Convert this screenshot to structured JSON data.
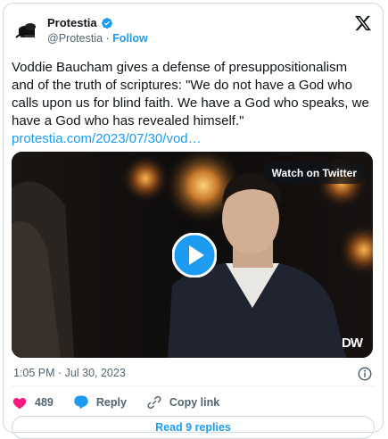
{
  "tweet": {
    "author_name": "Protestia",
    "handle": "@Protestia",
    "separator": "·",
    "follow_label": "Follow",
    "text": "Voddie Baucham gives a defense of presuppositionalism and of the truth of scriptures: \"We do not have a God who calls upon us for blind faith. We have a God who speaks, we have a God who has revealed himself.\" ",
    "link_text": "protestia.com/2023/07/30/vod…",
    "timestamp": "1:05 PM · Jul 30, 2023"
  },
  "video": {
    "watch_label": "Watch on Twitter",
    "watermark": "DW"
  },
  "actions": {
    "like_count": "489",
    "reply_label": "Reply",
    "copy_label": "Copy link"
  },
  "read_replies_label": "Read 9 replies",
  "colors": {
    "accent": "#1d9bf0",
    "like": "#f91880",
    "text": "#0f1419",
    "muted": "#536471",
    "border": "#cfd9de"
  }
}
